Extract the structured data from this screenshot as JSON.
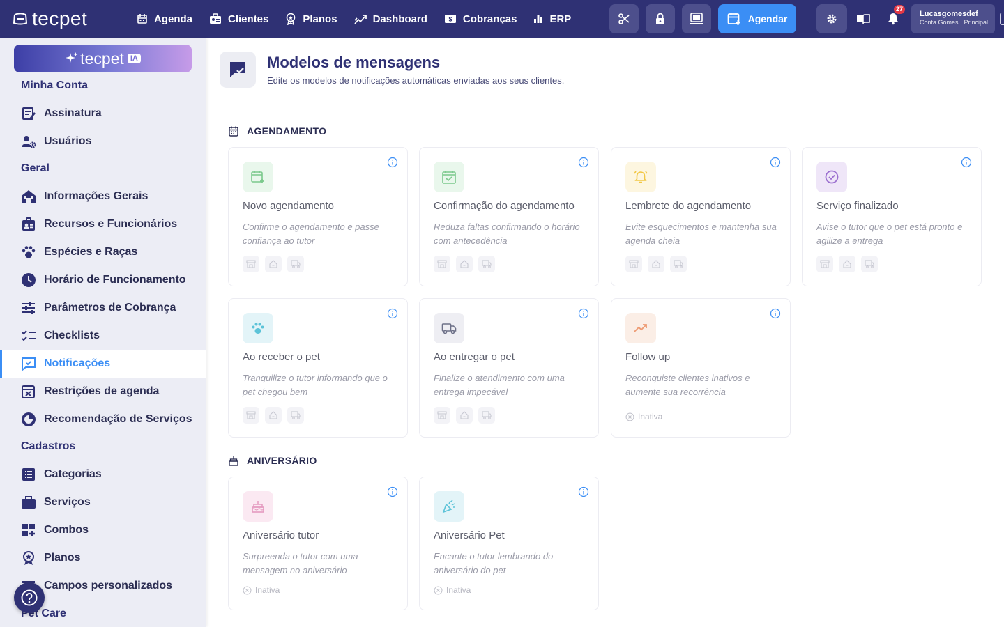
{
  "topbar": {
    "logo": "tecpet",
    "nav": [
      {
        "label": "Agenda",
        "icon": "calendar-icon"
      },
      {
        "label": "Clientes",
        "icon": "clients-icon"
      },
      {
        "label": "Planos",
        "icon": "plans-icon"
      },
      {
        "label": "Dashboard",
        "icon": "dashboard-icon"
      },
      {
        "label": "Cobranças",
        "icon": "billing-icon"
      },
      {
        "label": "ERP",
        "icon": "bar-chart-icon"
      }
    ],
    "schedule_button": "Agendar",
    "notification_count": "27",
    "user_name": "Lucasgomesdef",
    "user_account": "Conta Gomes · Principal"
  },
  "sidebar": {
    "ia_label": "tecpet",
    "ia_badge": "IA",
    "sections": {
      "account": "Minha Conta",
      "general": "Geral",
      "registers": "Cadastros",
      "petcare": "Pet Care"
    },
    "items": {
      "subscription": "Assinatura",
      "users": "Usuários",
      "general_info": "Informações Gerais",
      "resources": "Recursos e Funcionários",
      "species": "Espécies e Raças",
      "hours": "Horário de Funcionamento",
      "billing_params": "Parâmetros de Cobrança",
      "checklists": "Checklists",
      "notifications": "Notificações",
      "restrictions": "Restrições de agenda",
      "recommendation": "Recomendação de Serviços",
      "categories": "Categorias",
      "services": "Serviços",
      "combos": "Combos",
      "plans": "Planos",
      "custom_fields": "Campos personalizados"
    }
  },
  "main": {
    "title": "Modelos de mensagens",
    "subtitle": "Edite os modelos de notificações automáticas enviadas aos seus clientes.",
    "groups": {
      "scheduling": "AGENDAMENTO",
      "birthday": "ANIVERSÁRIO"
    },
    "cards": {
      "new": {
        "title": "Novo agendamento",
        "desc": "Confirme o agendamento e passe confiança ao tutor"
      },
      "confirm": {
        "title": "Confirmação do agendamento",
        "desc": "Reduza faltas confirmando o horário com antecedência"
      },
      "reminder": {
        "title": "Lembrete do agendamento",
        "desc": "Evite esquecimentos e mantenha sua agenda cheia"
      },
      "finished": {
        "title": "Serviço finalizado",
        "desc": "Avise o tutor que o pet está pronto e agilize a entrega"
      },
      "receive": {
        "title": "Ao receber o pet",
        "desc": "Tranquilize o tutor informando que o pet chegou bem"
      },
      "deliver": {
        "title": "Ao entregar o pet",
        "desc": "Finalize o atendimento com uma entrega impecável"
      },
      "followup": {
        "title": "Follow up",
        "desc": "Reconquiste clientes inativos e aumente sua recorrência",
        "status": "Inativa"
      },
      "bday_tutor": {
        "title": "Aniversário tutor",
        "desc": "Surpreenda o tutor com uma mensagem no aniversário",
        "status": "Inativa"
      },
      "bday_pet": {
        "title": "Aniversário Pet",
        "desc": "Encante o tutor lembrando do aniversário do pet",
        "status": "Inativa"
      }
    }
  },
  "colors": {
    "topbar": "#2f3174",
    "accent": "#3b8ef5",
    "sidebar": "#ecedf5"
  }
}
